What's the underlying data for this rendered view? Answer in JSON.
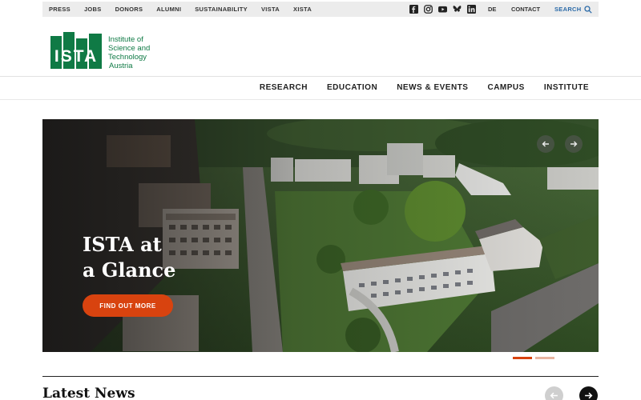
{
  "topbar": {
    "links": [
      "PRESS",
      "JOBS",
      "DONORS",
      "ALUMNI",
      "SUSTAINABILITY",
      "VISTA",
      "XISTA"
    ],
    "social": [
      "facebook-icon",
      "instagram-icon",
      "youtube-icon",
      "bluesky-icon",
      "linkedin-icon"
    ],
    "language": "DE",
    "contact": "CONTACT",
    "search": "SEARCH"
  },
  "logo": {
    "mark": "ISTA",
    "line1": "Institute of",
    "line2": "Science and",
    "line3": "Technology",
    "line4": "Austria"
  },
  "nav": [
    "RESEARCH",
    "EDUCATION",
    "NEWS & EVENTS",
    "CAMPUS",
    "INSTITUTE"
  ],
  "hero": {
    "title_line1": "ISTA at",
    "title_line2": "a Glance",
    "button": "FIND OUT MORE",
    "slide_count": 2,
    "active_slide": 1
  },
  "news": {
    "title": "Latest News"
  },
  "colors": {
    "brand_green": "#0f7a45",
    "accent_orange": "#d8430f",
    "search_blue": "#2a6aa8"
  }
}
